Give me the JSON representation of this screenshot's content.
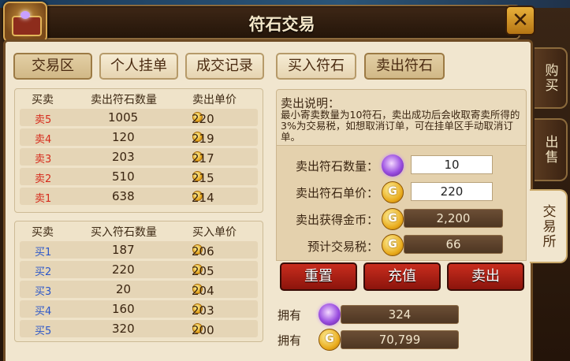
{
  "window": {
    "title": "符石交易",
    "close_label": "✕"
  },
  "side_tabs": [
    {
      "label": "购买",
      "active": false
    },
    {
      "label": "出售",
      "active": false
    },
    {
      "label": "交易所",
      "active": true
    }
  ],
  "left_tabs": [
    {
      "label": "交易区",
      "selected": true
    },
    {
      "label": "个人挂单",
      "selected": false
    },
    {
      "label": "成交记录",
      "selected": false
    }
  ],
  "right_tabs": [
    {
      "label": "买入符石",
      "selected": false
    },
    {
      "label": "卖出符石",
      "selected": true
    }
  ],
  "sell_table": {
    "headers": [
      "买卖",
      "卖出符石数量",
      "卖出单价"
    ],
    "rows": [
      {
        "side": "卖5",
        "quantity": "1005",
        "price": "220"
      },
      {
        "side": "卖4",
        "quantity": "120",
        "price": "219"
      },
      {
        "side": "卖3",
        "quantity": "203",
        "price": "217"
      },
      {
        "side": "卖2",
        "quantity": "510",
        "price": "215"
      },
      {
        "side": "卖1",
        "quantity": "638",
        "price": "214"
      }
    ]
  },
  "buy_table": {
    "headers": [
      "买卖",
      "买入符石数量",
      "买入单价"
    ],
    "rows": [
      {
        "side": "买1",
        "quantity": "187",
        "price": "206"
      },
      {
        "side": "买2",
        "quantity": "220",
        "price": "205"
      },
      {
        "side": "买3",
        "quantity": "20",
        "price": "204"
      },
      {
        "side": "买4",
        "quantity": "160",
        "price": "203"
      },
      {
        "side": "买5",
        "quantity": "320",
        "price": "200"
      }
    ]
  },
  "sell_info": {
    "heading": "卖出说明：",
    "text": "最小寄卖数量为10符石，卖出成功后会收取寄卖所得的3%为交易税，如想取消订单，可在挂单区手动取消订单。"
  },
  "sell_form": {
    "quantity_label": "卖出符石数量：",
    "quantity_value": "10",
    "price_label": "卖出符石单价：",
    "price_value": "220",
    "gold_label": "卖出获得金币：",
    "gold_value": "2,200",
    "tax_label": "预计交易税：",
    "tax_value": "66"
  },
  "actions": {
    "reset": "重置",
    "recharge": "充值",
    "sell": "卖出"
  },
  "owned": {
    "label": "拥有",
    "runestones": "324",
    "gold": "70,799"
  },
  "colors": {
    "sell_side": "#d62b1c",
    "buy_side": "#2b56c9",
    "action_button": "#b0241a"
  },
  "icons": [
    "treasure-chest-icon",
    "close-icon",
    "gold-coin-icon",
    "runestone-gem-icon"
  ]
}
